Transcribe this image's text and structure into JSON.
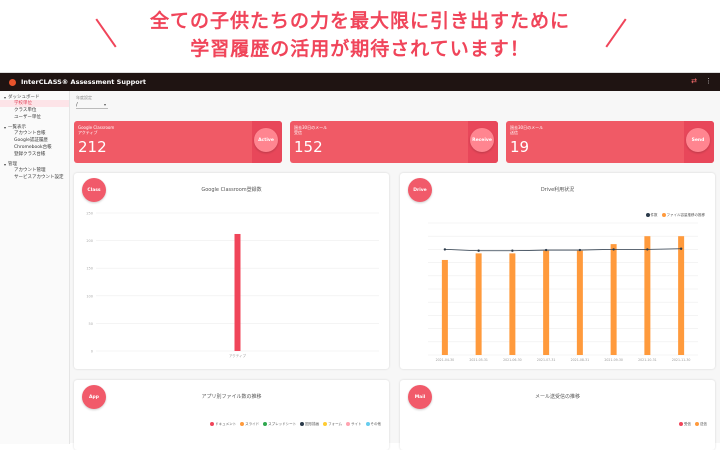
{
  "banner": {
    "line1": "全ての子供たちの力を最大限に引き出すために",
    "line2": "学習履歴の活用が期待されています！"
  },
  "app": {
    "title": "InterCLASS® Assessment Support"
  },
  "sidebar": {
    "groups": [
      {
        "title": "ダッシュボード",
        "items": [
          {
            "label": "学校単位",
            "active": true
          },
          {
            "label": "クラス単位",
            "active": false
          },
          {
            "label": "ユーザー単位",
            "active": false
          }
        ]
      },
      {
        "title": "一覧表示",
        "items": [
          {
            "label": "アカウント台帳",
            "active": false
          },
          {
            "label": "Google認証履歴",
            "active": false
          },
          {
            "label": "Chromebook台帳",
            "active": false
          },
          {
            "label": "登録クラス台帳",
            "active": false
          }
        ]
      },
      {
        "title": "管理",
        "items": [
          {
            "label": "アカウント管理",
            "active": false
          },
          {
            "label": "サービスアカウント設定",
            "active": false
          }
        ]
      }
    ]
  },
  "year_select": {
    "label": "年度設定",
    "value": "/"
  },
  "stats": [
    {
      "sub1": "Google Classroom",
      "sub2": "アクティブ",
      "value": "212",
      "badge": "Active"
    },
    {
      "sub1": "過去30日のメール",
      "sub2": "受信",
      "value": "152",
      "badge": "Receive"
    },
    {
      "sub1": "過去30日のメール",
      "sub2": "送信",
      "value": "19",
      "badge": "Send"
    }
  ],
  "panels": {
    "classroom": {
      "badge": "Class",
      "title": "Google Classroom登録数"
    },
    "drive": {
      "badge": "Drive",
      "title": "Drive利用状況"
    },
    "apps": {
      "badge": "App",
      "title": "アプリ別ファイル数の推移"
    },
    "mail": {
      "badge": "Mail",
      "title": "メール送受信の推移"
    }
  },
  "chart_data": [
    {
      "type": "bar",
      "title": "Google Classroom登録数",
      "categories": [
        "アクティブ"
      ],
      "values": [
        212
      ],
      "ylim": [
        0,
        250
      ],
      "yticks": [
        0,
        50,
        100,
        150,
        200,
        250
      ],
      "colors": [
        "#f0455a"
      ]
    },
    {
      "type": "bar",
      "title": "Drive利用状況",
      "categories": [
        "2021-04-30",
        "2021-05-31",
        "2021-06-30",
        "2021-07-31",
        "2021-08-31",
        "2021-09-30",
        "2021-10-31",
        "2021-11-30"
      ],
      "series": [
        {
          "name": "件数",
          "type": "line",
          "values": [
            800,
            790,
            790,
            795,
            795,
            800,
            800,
            805
          ],
          "color": "#2b3a4a"
        },
        {
          "name": "ファイル容量推移の推移",
          "type": "bar",
          "values": [
            720,
            770,
            770,
            790,
            790,
            840,
            900,
            900
          ],
          "color": "#ff9a3c"
        }
      ],
      "ylim": [
        0,
        1000
      ]
    }
  ],
  "legends": {
    "drive": [
      {
        "label": "件数",
        "color": "#2b3a4a"
      },
      {
        "label": "ファイル容量推移の推移",
        "color": "#ff9a3c"
      }
    ],
    "apps": [
      {
        "label": "ドキュメント",
        "color": "#f0455a"
      },
      {
        "label": "スライド",
        "color": "#ff9a3c"
      },
      {
        "label": "スプレッドシート",
        "color": "#2fa84f"
      },
      {
        "label": "図形描画",
        "color": "#2b3a4a"
      },
      {
        "label": "フォーム",
        "color": "#ffcc33"
      },
      {
        "label": "サイト",
        "color": "#ffa3b0"
      },
      {
        "label": "その他",
        "color": "#66ccee"
      }
    ],
    "mail": [
      {
        "label": "受信",
        "color": "#f0455a"
      },
      {
        "label": "送信",
        "color": "#ff9a3c"
      }
    ]
  }
}
